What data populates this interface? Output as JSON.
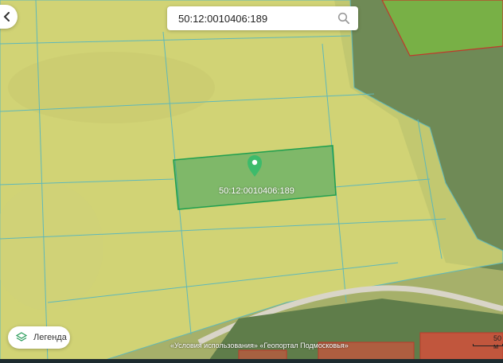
{
  "search": {
    "value": "50:12:0010406:189",
    "placeholder": ""
  },
  "parcel": {
    "label": "50:12:0010406:189",
    "highlight_color": "#2e9e5e"
  },
  "legend": {
    "label": "Легенда"
  },
  "footer": {
    "terms": "«Условия использования» «Геопортал Подмосковья»"
  },
  "scale": {
    "label": "50 м"
  },
  "colors": {
    "cadastral_fill": "#e2e07a",
    "cadastral_border": "#5fb8b8",
    "selected_border": "#1f9f4f",
    "forest_parcel": "#7fcf3a",
    "building_parcel": "#e24a3a"
  },
  "icons": {
    "back": "chevron-left-icon",
    "search": "search-icon",
    "legend": "layers-icon",
    "marker": "map-pin-icon"
  }
}
